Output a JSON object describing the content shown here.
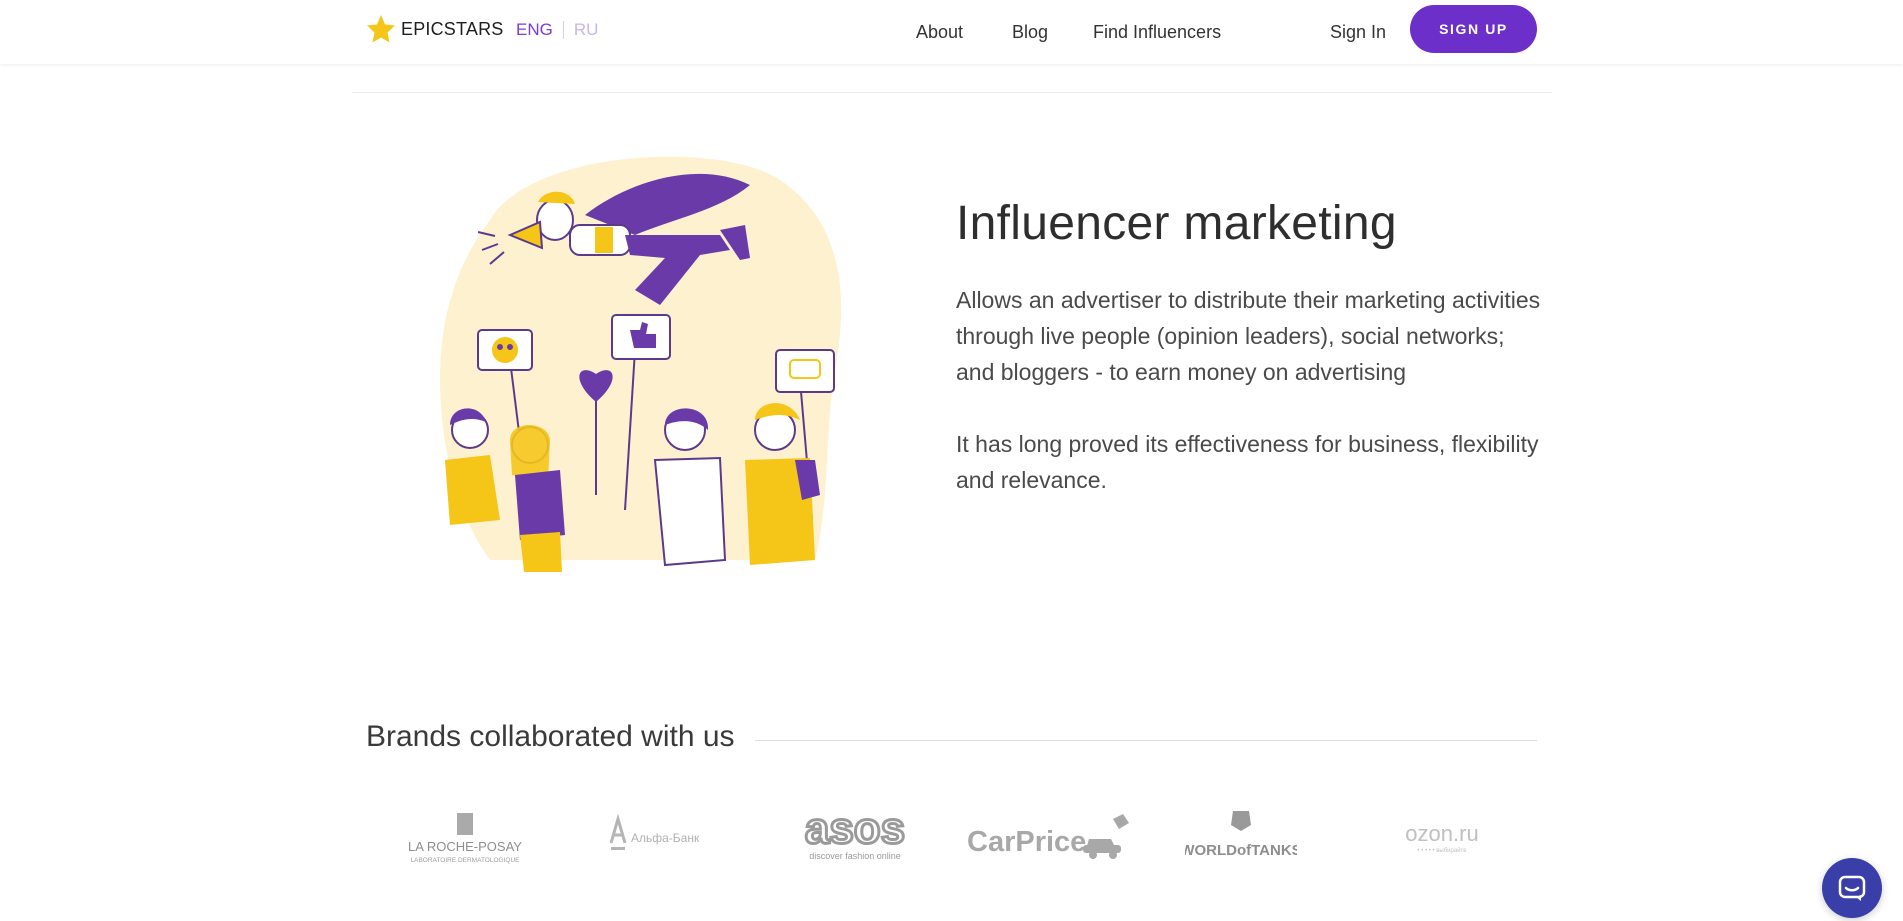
{
  "header": {
    "logo_text": "EPICSTARS",
    "lang_eng": "ENG",
    "lang_ru": "RU",
    "nav": [
      "About",
      "Blog",
      "Find Influencers"
    ],
    "sign_in": "Sign In",
    "sign_up": "SIGN UP"
  },
  "hero": {
    "title": "Influencer marketing",
    "paragraph1": "Allows an advertiser to distribute their marketing activities through live people (opinion leaders), social networks; and bloggers - to earn money on advertising",
    "paragraph2": "It has long proved its effectiveness for business, flexibility and relevance."
  },
  "brands": {
    "title": "Brands collaborated with us",
    "logos": [
      {
        "name": "LA ROCHE-POSAY",
        "sub": "LABORATOIRE DERMATOLOGIQUE"
      },
      {
        "name": "Альфа-Банк",
        "sub": ""
      },
      {
        "name": "asos",
        "sub": "discover fashion online"
      },
      {
        "name": "CarPrice",
        "sub": ""
      },
      {
        "name": "WORLDofTANKS",
        "sub": ""
      },
      {
        "name": "ozon.ru",
        "sub": "• • • • • выбирайте"
      }
    ]
  },
  "colors": {
    "accent": "#6c2fc9",
    "lang_active": "#7a3ed6",
    "yellow": "#f5c518",
    "cream": "#fdf1cf",
    "chat": "#3a3ea8"
  },
  "icons": {
    "logo": "star-icon",
    "chat": "chat-icon"
  }
}
